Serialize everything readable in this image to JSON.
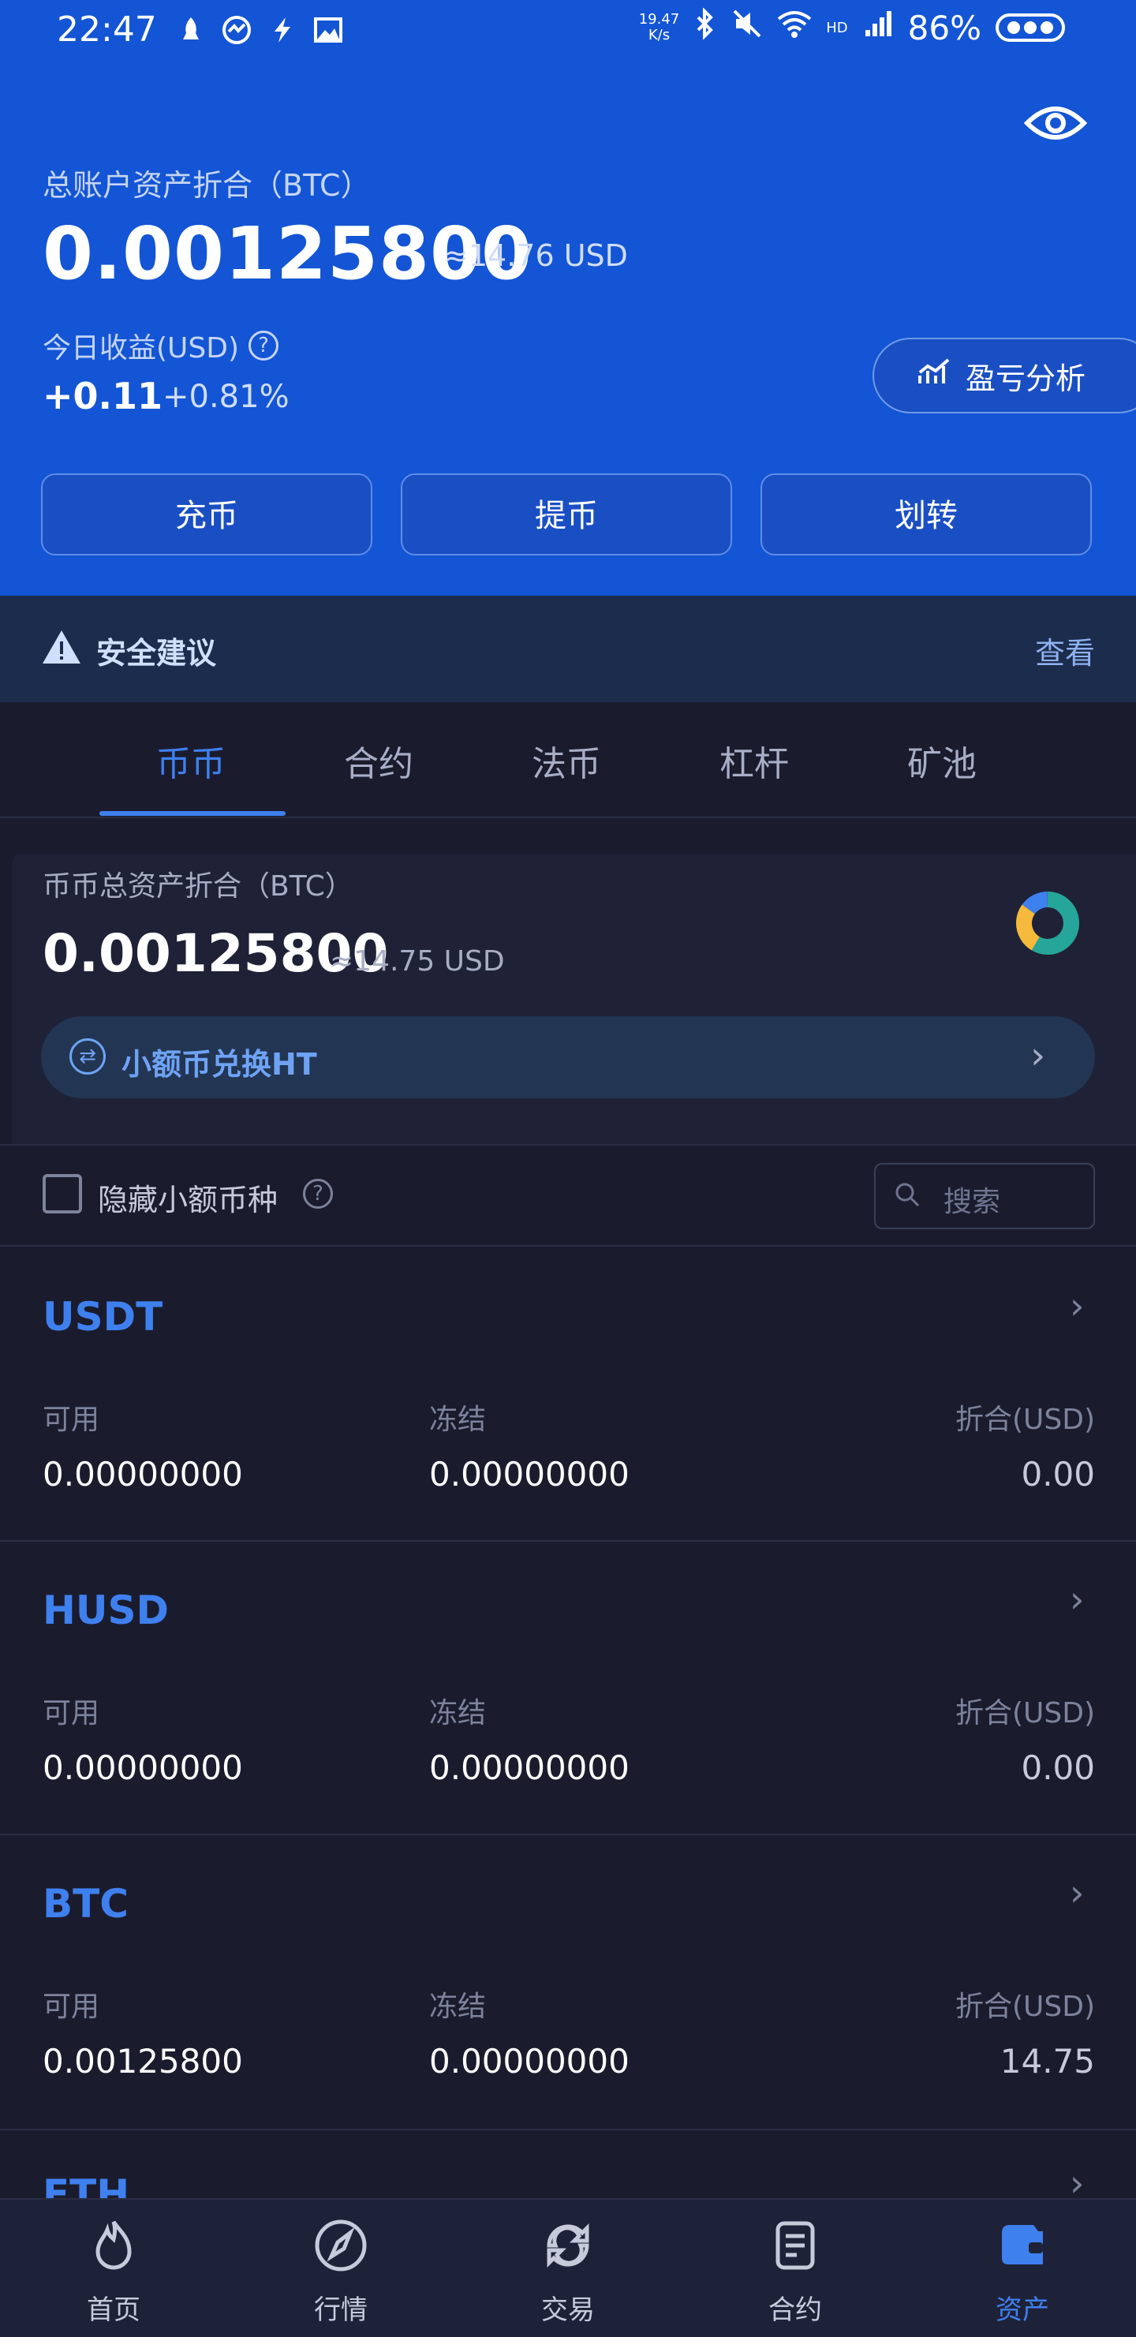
{
  "status_bar": {
    "time": "22:47",
    "net_speed": "19.47\nK/s",
    "battery": "86%",
    "hd": "HD",
    "signal": "4G"
  },
  "header": {
    "total_label": "总账户资产折合（BTC）",
    "total_btc": "0.00125800",
    "total_usd": "≈14.76 USD",
    "today_label": "今日收益(USD)",
    "today_value": "+0.11",
    "today_pct": "+0.81%",
    "pnl_button": "盈亏分析",
    "actions": [
      "充币",
      "提币",
      "划转"
    ]
  },
  "security": {
    "label": "安全建议",
    "view": "查看"
  },
  "tabs": [
    "币币",
    "合约",
    "法币",
    "杠杆",
    "矿池"
  ],
  "summary": {
    "label": "币币总资产折合（BTC）",
    "btc": "0.00125800",
    "usd": "≈14.75 USD",
    "convert": "小额币兑换HT"
  },
  "filter": {
    "hide_label": "隐藏小额币种",
    "search_placeholder": "搜索"
  },
  "assets": [
    {
      "name": "USDT",
      "avail_label": "可用",
      "avail": "0.00000000",
      "frozen_label": "冻结",
      "frozen": "0.00000000",
      "usd_label": "折合(USD)",
      "usd": "0.00"
    },
    {
      "name": "HUSD",
      "avail_label": "可用",
      "avail": "0.00000000",
      "frozen_label": "冻结",
      "frozen": "0.00000000",
      "usd_label": "折合(USD)",
      "usd": "0.00"
    },
    {
      "name": "BTC",
      "avail_label": "可用",
      "avail": "0.00125800",
      "frozen_label": "冻结",
      "frozen": "0.00000000",
      "usd_label": "折合(USD)",
      "usd": "14.75"
    },
    {
      "name": "ETH"
    }
  ],
  "bottom_nav": [
    {
      "label": "首页",
      "icon": "home-flame-icon"
    },
    {
      "label": "行情",
      "icon": "market-compass-icon"
    },
    {
      "label": "交易",
      "icon": "trade-exchange-icon"
    },
    {
      "label": "合约",
      "icon": "contract-document-icon"
    },
    {
      "label": "资产",
      "icon": "wallet-icon",
      "active": true
    }
  ],
  "colors": {
    "header_bg": "#1355d4",
    "body_bg": "#1a1c2e",
    "accent": "#3f80ef"
  }
}
